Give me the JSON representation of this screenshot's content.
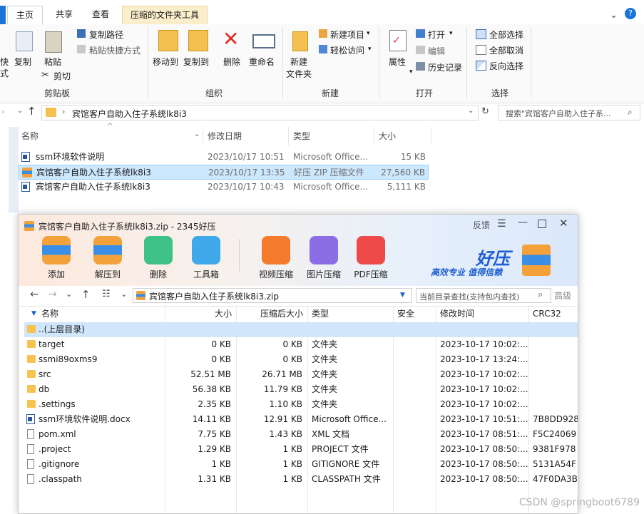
{
  "ribbon_tabs": {
    "home": "主页",
    "share": "共享",
    "view": "查看",
    "tools": "压缩的文件夹工具"
  },
  "ribbon": {
    "clipboard": {
      "cut_left": "快",
      "cut_left2": "式",
      "copy": "复制",
      "paste": "粘贴",
      "copy_path": "复制路径",
      "paste_shortcut": "粘贴快捷方式",
      "cut": "剪切",
      "group": "剪贴板"
    },
    "organize": {
      "move_to": "移动到",
      "copy_to": "复制到",
      "delete": "删除",
      "rename": "重命名",
      "group": "组织"
    },
    "new": {
      "new_folder_1": "新建",
      "new_folder_2": "文件夹",
      "new_item": "新建项目",
      "easy_access": "轻松访问",
      "group": "新建"
    },
    "open": {
      "properties": "属性",
      "open": "打开",
      "edit": "编辑",
      "history": "历史记录",
      "group": "打开"
    },
    "select": {
      "select_all": "全部选择",
      "select_none": "全部取消",
      "invert": "反向选择",
      "group": "选择"
    }
  },
  "address": {
    "path": "宾馆客户自助入住子系统lk8i3",
    "search_placeholder": "搜索\"宾馆客户自助入住子系..."
  },
  "explorer_columns": {
    "name": "名称",
    "modified": "修改日期",
    "type": "类型",
    "size": "大小"
  },
  "explorer_files": [
    {
      "name": "ssm环境软件说明",
      "modified": "2023/10/17 10:51",
      "type": "Microsoft Office...",
      "size": "15 KB",
      "icon": "docx-icon"
    },
    {
      "name": "宾馆客户自助入住子系统lk8i3",
      "modified": "2023/10/17 13:35",
      "type": "好压 ZIP 压缩文件",
      "size": "27,560 KB",
      "icon": "zip-icon"
    },
    {
      "name": "宾馆客户自助入住子系统lk8i3",
      "modified": "2023/10/17 10:43",
      "type": "Microsoft Office...",
      "size": "5,111 KB",
      "icon": "docx-icon"
    }
  ],
  "zip_window": {
    "title": "宾馆客户自助入住子系统lk8i3.zip - 2345好压",
    "feedback": "反馈",
    "tools": [
      "添加",
      "解压到",
      "删除",
      "工具箱",
      "视频压缩",
      "图片压缩",
      "PDF压缩"
    ],
    "brand": "好压",
    "slogan": "高效专业 值得信赖",
    "path": "宾馆客户自助入住子系统lk8i3.zip",
    "search_placeholder": "当前目录查找(支持包内查找)",
    "advanced": "高级",
    "columns": {
      "name": "名称",
      "size": "大小",
      "packed": "压缩后大小",
      "type": "类型",
      "security": "安全",
      "modified": "修改时间",
      "crc": "CRC32"
    },
    "rows": [
      {
        "name": "..(上层目录)",
        "size": "",
        "packed": "",
        "type": "",
        "modified": "",
        "crc": "",
        "icon": "folder"
      },
      {
        "name": "target",
        "size": "0 KB",
        "packed": "0 KB",
        "type": "文件夹",
        "modified": "2023-10-17 10:02:...",
        "crc": "",
        "icon": "folder"
      },
      {
        "name": "ssmi89oxms9",
        "size": "0 KB",
        "packed": "0 KB",
        "type": "文件夹",
        "modified": "2023-10-17 13:24:...",
        "crc": "",
        "icon": "folder"
      },
      {
        "name": "src",
        "size": "52.51 MB",
        "packed": "26.71 MB",
        "type": "文件夹",
        "modified": "2023-10-17 10:02:...",
        "crc": "",
        "icon": "folder"
      },
      {
        "name": "db",
        "size": "56.38 KB",
        "packed": "11.79 KB",
        "type": "文件夹",
        "modified": "2023-10-17 10:02:...",
        "crc": "",
        "icon": "folder"
      },
      {
        "name": ".settings",
        "size": "2.35 KB",
        "packed": "1.10 KB",
        "type": "文件夹",
        "modified": "2023-10-17 10:02:...",
        "crc": "",
        "icon": "folder"
      },
      {
        "name": "ssm环境软件说明.docx",
        "size": "14.11 KB",
        "packed": "12.91 KB",
        "type": "Microsoft Office...",
        "modified": "2023-10-17 10:51:...",
        "crc": "7B8DD928",
        "icon": "docx"
      },
      {
        "name": "pom.xml",
        "size": "7.75 KB",
        "packed": "1.43 KB",
        "type": "XML 文档",
        "modified": "2023-10-17 08:51:...",
        "crc": "F5C24069",
        "icon": "file"
      },
      {
        "name": ".project",
        "size": "1.29 KB",
        "packed": "1 KB",
        "type": "PROJECT 文件",
        "modified": "2023-10-17 08:50:...",
        "crc": "9381F978",
        "icon": "file"
      },
      {
        "name": ".gitignore",
        "size": "1 KB",
        "packed": "1 KB",
        "type": "GITIGNORE 文件",
        "modified": "2023-10-17 08:50:...",
        "crc": "5131A54F",
        "icon": "file"
      },
      {
        "name": ".classpath",
        "size": "1.31 KB",
        "packed": "1 KB",
        "type": "CLASSPATH 文件",
        "modified": "2023-10-17 08:50:...",
        "crc": "47F0DA3B",
        "icon": "file"
      }
    ]
  },
  "watermark": "CSDN @springboot6789"
}
